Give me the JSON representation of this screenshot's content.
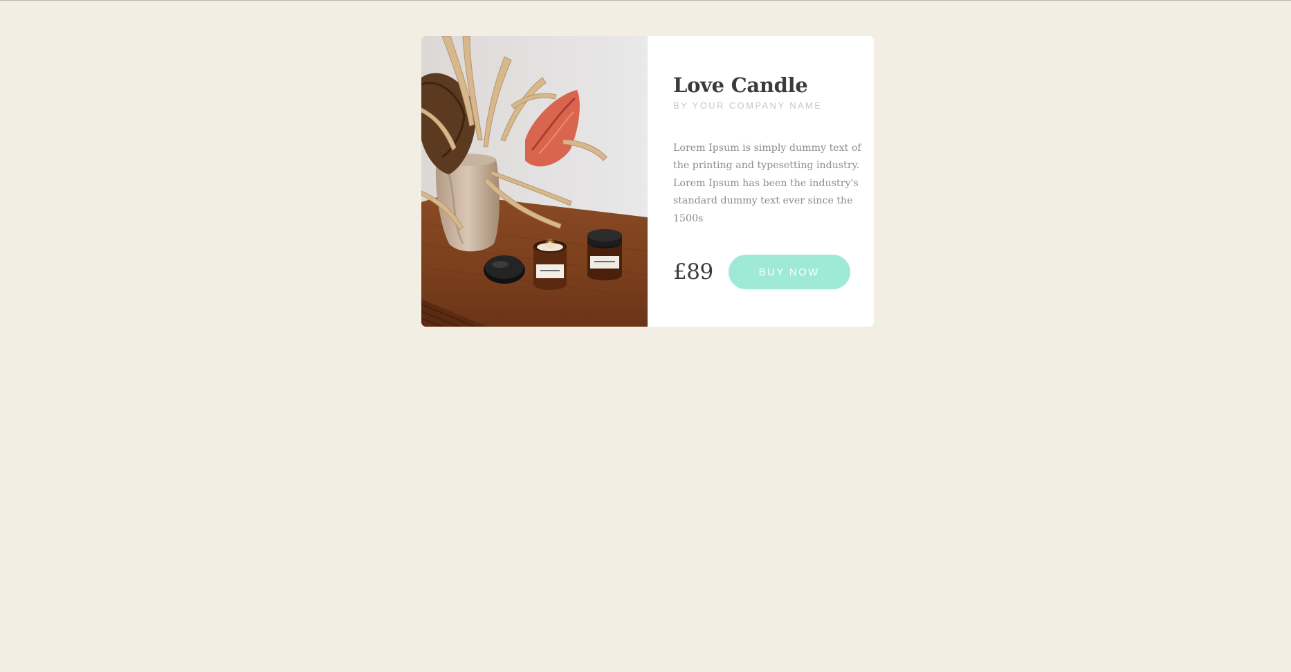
{
  "product": {
    "title": "Love Candle",
    "subtitle": "BY YOUR COMPANY NAME",
    "description": "Lorem Ipsum is simply dummy text of the printing and typesetting industry. Lorem Ipsum has been the industry's standard dummy text ever since the 1500s",
    "price": "£89",
    "buy_label": "BUY NOW",
    "image_alt": "Candles in amber jars on a wooden table beside a vase of dried flowers"
  },
  "colors": {
    "background": "#f2eee3",
    "card": "#ffffff",
    "title": "#3a3b3e",
    "subtitle": "#c4c7cb",
    "description": "#8c8c8c",
    "button": "#9fe9d8",
    "button_text": "#ffffff"
  }
}
